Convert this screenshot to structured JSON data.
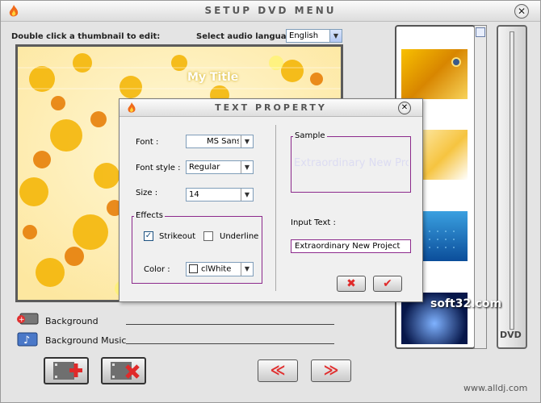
{
  "window": {
    "title": "SETUP DVD MENU",
    "close_label": "✕"
  },
  "instructions": {
    "thumb_hint": "Double click a thumbnail to edit:",
    "audio_lang_label": "Select audio language :",
    "audio_lang_value": "English"
  },
  "preview": {
    "title_text": "My Title"
  },
  "bottom": {
    "background_label": "Background",
    "music_label": "Background Music"
  },
  "side": {
    "dvd_label": "DVD"
  },
  "watermarks": {
    "soft32": "soft32.com",
    "alldj": "www.alldj.com"
  },
  "dialog": {
    "title": "TEXT PROPERTY",
    "close_label": "✕",
    "font_label": "Font :",
    "font_value": "MS Sans S",
    "style_label": "Font style :",
    "style_value": "Regular",
    "size_label": "Size :",
    "size_value": "14",
    "effects_label": "Effects",
    "strikeout_label": "Strikeout",
    "underline_label": "Underline",
    "color_label": "Color :",
    "color_value": "clWhite",
    "sample_label": "Sample",
    "sample_text": "Extraordinary New Project",
    "input_label": "Input Text :",
    "input_value": "Extraordinary New Project"
  },
  "colors": {
    "accent": "#8c2a8c",
    "title_gray": "#5a5a5a"
  }
}
